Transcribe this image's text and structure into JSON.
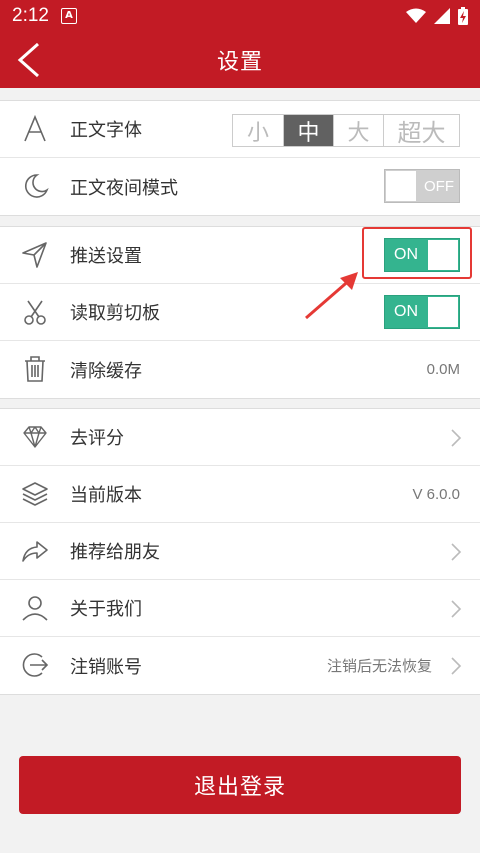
{
  "status": {
    "time": "2:12",
    "notif": "A"
  },
  "appbar": {
    "title": "设置"
  },
  "section1": {
    "font": {
      "label": "正文字体",
      "options": [
        "小",
        "中",
        "大",
        "超大"
      ],
      "selected": "中"
    },
    "night": {
      "label": "正文夜间模式",
      "toggle": "OFF"
    }
  },
  "section2": {
    "push": {
      "label": "推送设置",
      "toggle": "ON"
    },
    "clipboard": {
      "label": "读取剪切板",
      "toggle": "ON"
    },
    "cache": {
      "label": "清除缓存",
      "value": "0.0M"
    }
  },
  "section3": {
    "rate": {
      "label": "去评分"
    },
    "version": {
      "label": "当前版本",
      "value": "V 6.0.0"
    },
    "recommend": {
      "label": "推荐给朋友"
    },
    "about": {
      "label": "关于我们"
    },
    "deregister": {
      "label": "注销账号",
      "value": "注销后无法恢复"
    }
  },
  "logout": {
    "label": "退出登录"
  },
  "colors": {
    "brand": "#c21b25",
    "toggle_on": "#34b48f",
    "highlight": "#e53935"
  }
}
